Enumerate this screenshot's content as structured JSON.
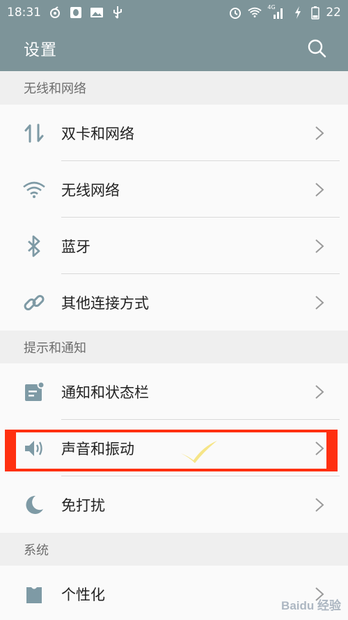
{
  "status_bar": {
    "time": "18:31",
    "network_label": "4G",
    "battery": "22"
  },
  "app_bar": {
    "title": "设置"
  },
  "sections": [
    {
      "header": "无线和网络",
      "items": [
        {
          "label": "双卡和网络",
          "icon": "dual-sim-arrows-icon"
        },
        {
          "label": "无线网络",
          "icon": "wifi-icon"
        },
        {
          "label": "蓝牙",
          "icon": "bluetooth-icon"
        },
        {
          "label": "其他连接方式",
          "icon": "link-icon"
        }
      ]
    },
    {
      "header": "提示和通知",
      "items": [
        {
          "label": "通知和状态栏",
          "icon": "notification-icon"
        },
        {
          "label": "声音和振动",
          "icon": "speaker-icon",
          "highlighted": true
        },
        {
          "label": "免打扰",
          "icon": "moon-icon"
        }
      ]
    },
    {
      "header": "系统",
      "items": [
        {
          "label": "个性化",
          "icon": "personalize-icon"
        }
      ]
    }
  ],
  "watermark": "Baidu 经验",
  "colors": {
    "appbar": "#7d9499",
    "icon": "#7e9aa5",
    "highlight": "#ff3010",
    "checkmark": "#f5e27a"
  }
}
